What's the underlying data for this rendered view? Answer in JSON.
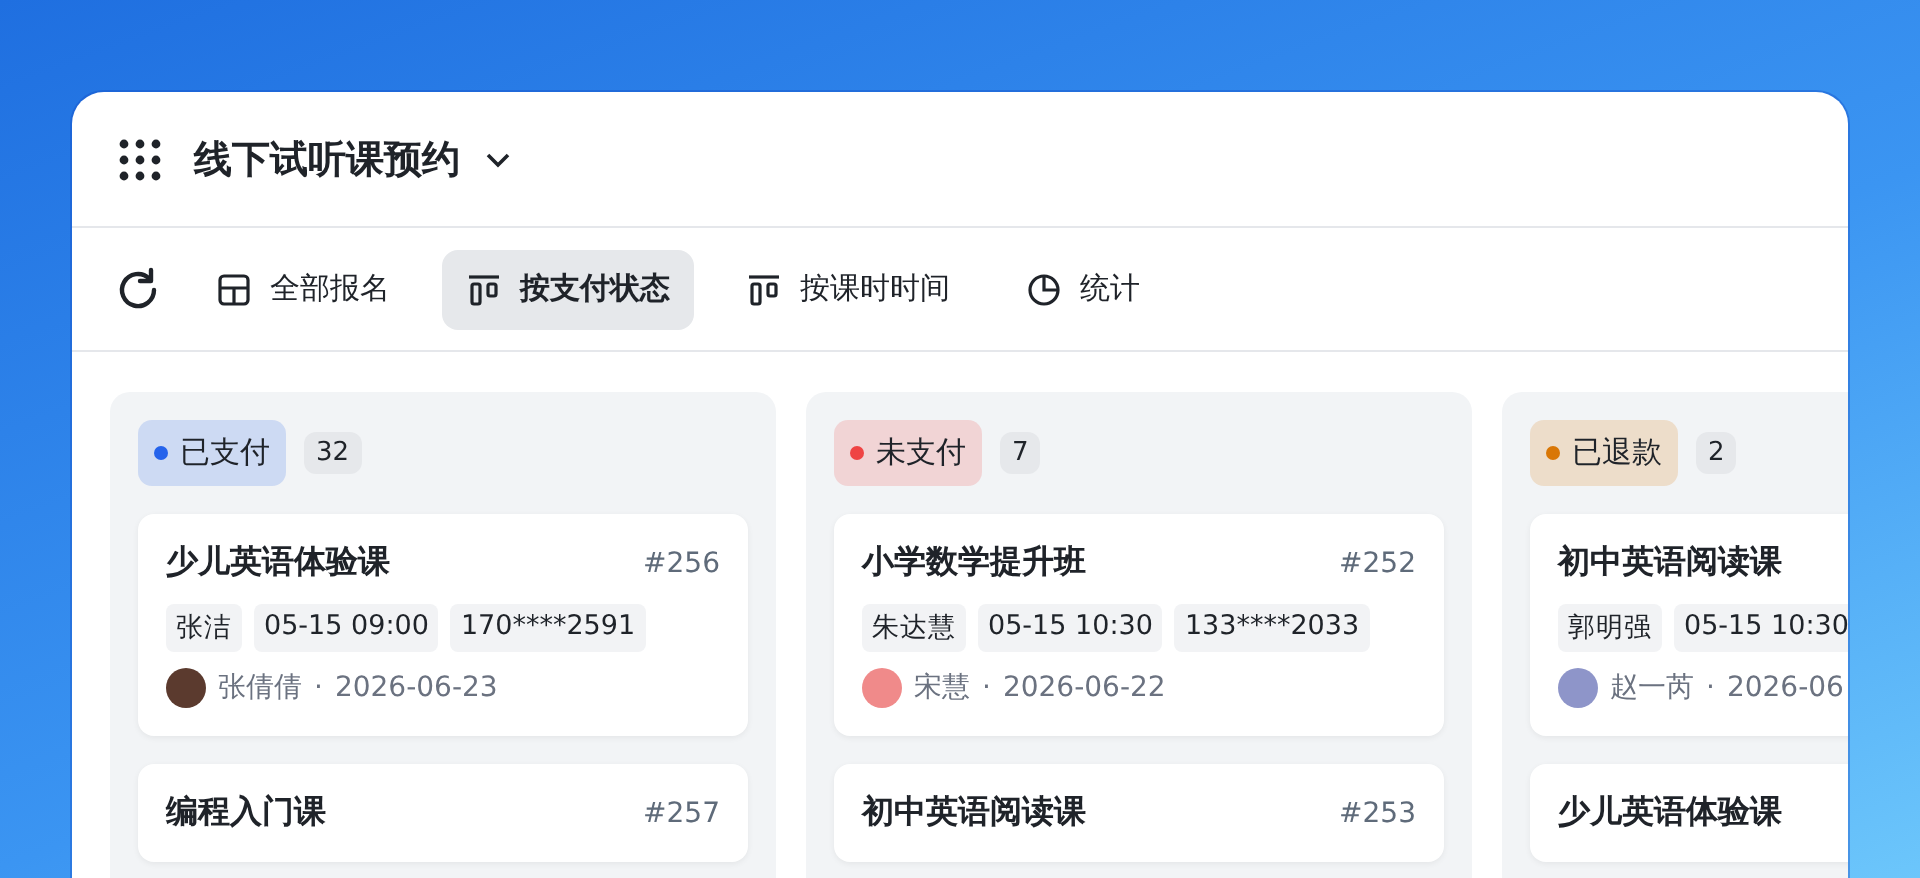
{
  "header": {
    "title": "线下试听课预约"
  },
  "toolbar": [
    {
      "kind": "table",
      "label": "全部报名",
      "selected": false
    },
    {
      "kind": "board",
      "label": "按支付状态",
      "selected": true
    },
    {
      "kind": "board",
      "label": "按课时时间",
      "selected": false
    },
    {
      "kind": "chart",
      "label": "统计",
      "selected": false
    }
  ],
  "columns": [
    {
      "status": "已支付",
      "color": "#2563eb",
      "count": "32",
      "cards": [
        {
          "title": "少儿英语体验课",
          "number": "#256",
          "tags": [
            "张洁",
            "05-15 09:00",
            "170****2591"
          ],
          "assignee": {
            "name": "张倩倩",
            "color": "#5b3a2e"
          },
          "separator": "·",
          "date": "2026-06-23"
        },
        {
          "title": "编程入门课",
          "number": "#257"
        }
      ]
    },
    {
      "status": "未支付",
      "color": "#ef4444",
      "count": "7",
      "cards": [
        {
          "title": "小学数学提升班",
          "number": "#252",
          "tags": [
            "朱达慧",
            "05-15 10:30",
            "133****2033"
          ],
          "assignee": {
            "name": "宋慧",
            "color": "#f08a8a"
          },
          "separator": "·",
          "date": "2026-06-22"
        },
        {
          "title": "初中英语阅读课",
          "number": "#253"
        }
      ]
    },
    {
      "status": "已退款",
      "color": "#d97706",
      "count": "2",
      "cards": [
        {
          "title": "初中英语阅读课",
          "tags": [
            "郭明强",
            "05-15 10:30"
          ],
          "assignee": {
            "name": "赵一芮",
            "color": "#8e95c9"
          },
          "separator": "·",
          "date": "2026-06"
        },
        {
          "title": "少儿英语体验课"
        }
      ]
    }
  ]
}
